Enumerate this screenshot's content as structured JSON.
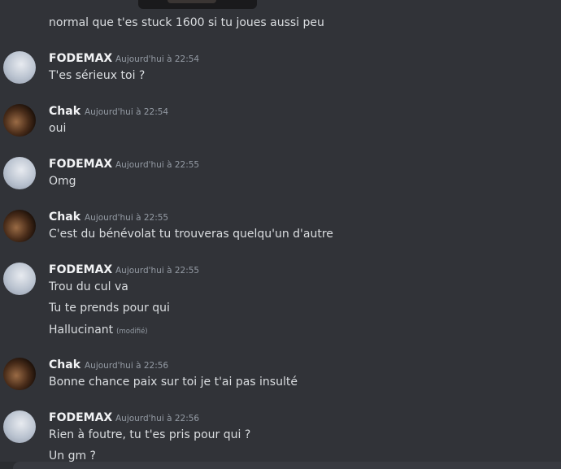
{
  "previous_message": {
    "text": "normal que t'es stuck 1600 si tu joues aussi peu"
  },
  "messages": [
    {
      "author": "FODEMAX",
      "time": "Aujourd'hui à 22:54",
      "lines": [
        "T'es sérieux toi ?"
      ]
    },
    {
      "author": "Chak",
      "time": "Aujourd'hui à 22:54",
      "lines": [
        "oui"
      ]
    },
    {
      "author": "FODEMAX",
      "time": "Aujourd'hui à 22:55",
      "lines": [
        "Omg"
      ]
    },
    {
      "author": "Chak",
      "time": "Aujourd'hui à 22:55",
      "lines": [
        "C'est du bénévolat tu trouveras quelqu'un d'autre"
      ]
    },
    {
      "author": "FODEMAX",
      "time": "Aujourd'hui à 22:55",
      "lines": [
        "Trou du cul va",
        "Tu te prends pour qui",
        "Hallucinant"
      ],
      "edited_label": "(modifié)"
    },
    {
      "author": "Chak",
      "time": "Aujourd'hui à 22:56",
      "lines": [
        "Bonne chance paix sur toi je t'ai pas insulté"
      ]
    },
    {
      "author": "FODEMAX",
      "time": "Aujourd'hui à 22:56",
      "lines": [
        "Rien à foutre, tu t'es pris pour qui ?",
        "Un gm ?"
      ]
    }
  ],
  "colors": {
    "background": "#313338",
    "text": "#dbdee1",
    "author": "#f2f3f5",
    "timestamp": "#949ba4"
  }
}
